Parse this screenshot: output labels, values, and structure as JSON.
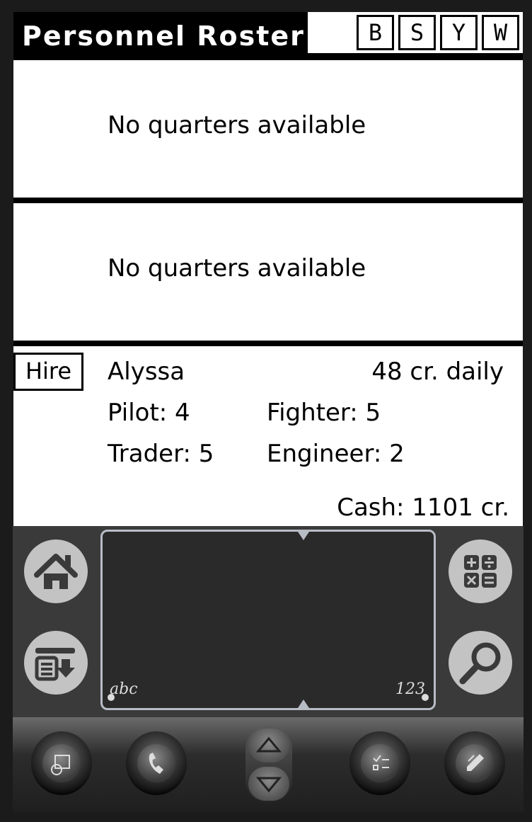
{
  "title": "Personnel Roster",
  "shortcuts": [
    "B",
    "S",
    "Y",
    "W"
  ],
  "slots": [
    {
      "text": "No quarters available"
    },
    {
      "text": "No quarters available"
    }
  ],
  "mercenary": {
    "hire_label": "Hire",
    "name": "Alyssa",
    "wage": "48 cr. daily",
    "pilot": "Pilot: 4",
    "fighter": "Fighter: 5",
    "trader": "Trader: 5",
    "engineer": "Engineer: 2"
  },
  "cash": "Cash: 1101 cr.",
  "graffiti": {
    "alpha_label": "abc",
    "numeric_label": "123"
  }
}
